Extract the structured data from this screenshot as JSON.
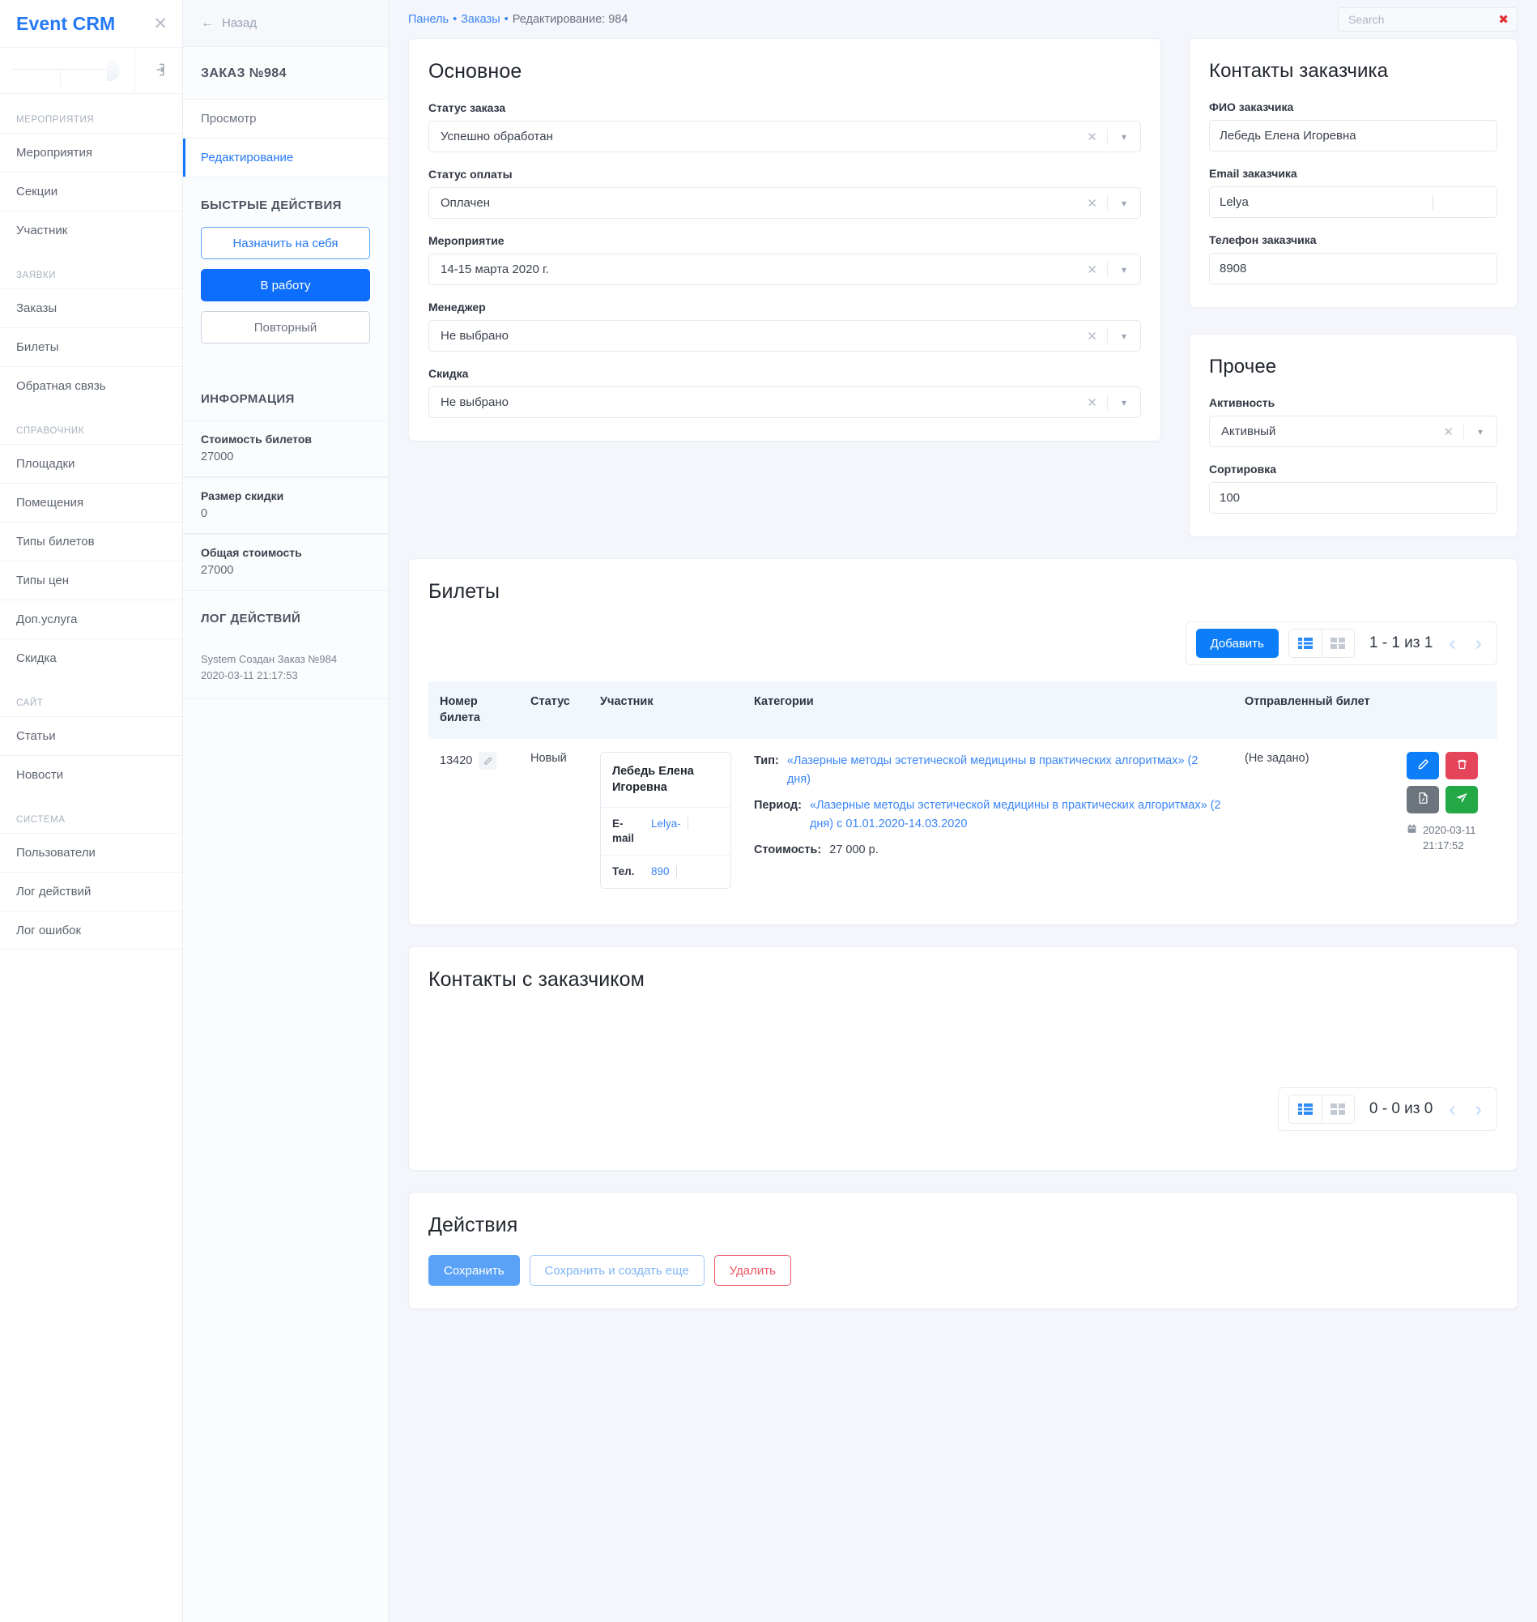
{
  "sidebar": {
    "brand": "Event CRM",
    "close_icon": "close-icon",
    "logout_icon": "logout-icon",
    "groups": [
      {
        "title": "МЕРОПРИЯТИЯ",
        "items": [
          "Мероприятия",
          "Секции",
          "Участник"
        ]
      },
      {
        "title": "ЗАЯВКИ",
        "items": [
          "Заказы",
          "Билеты",
          "Обратная связь"
        ]
      },
      {
        "title": "СПРАВОЧНИК",
        "items": [
          "Площадки",
          "Помещения",
          "Типы билетов",
          "Типы цен",
          "Доп.услуга",
          "Скидка"
        ]
      },
      {
        "title": "САЙТ",
        "items": [
          "Статьи",
          "Новости"
        ]
      },
      {
        "title": "СИСТЕМА",
        "items": [
          "Пользователи",
          "Лог действий",
          "Лог ошибок"
        ]
      }
    ]
  },
  "subsidebar": {
    "back_label": "Назад",
    "back_icon": "arrow-left-icon",
    "order_title": "ЗАКАЗ №984",
    "links": [
      {
        "label": "Просмотр",
        "active": false
      },
      {
        "label": "Редактирование",
        "active": true
      }
    ],
    "quick_actions_title": "БЫСТРЫЕ ДЕЙСТВИЯ",
    "quick_actions": [
      {
        "label": "Назначить на себя",
        "style": "outline-blue"
      },
      {
        "label": "В работу",
        "style": "solid-blue"
      },
      {
        "label": "Повторный",
        "style": "outline-grey"
      }
    ],
    "info_title": "ИНФОРМАЦИЯ",
    "info": [
      {
        "label": "Стоимость билетов",
        "value": "27000"
      },
      {
        "label": "Размер скидки",
        "value": "0"
      },
      {
        "label": "Общая стоимость",
        "value": "27000"
      }
    ],
    "log_title": "ЛОГ ДЕЙСТВИЙ",
    "log_entries": [
      {
        "text": "System Создан Заказ №984",
        "time": "2020-03-11 21:17:53"
      }
    ]
  },
  "topbar": {
    "crumb1": "Панель",
    "crumb2": "Заказы",
    "crumb3": "Редактирование: 984",
    "sep": "•",
    "search_placeholder": "Search",
    "search_value": "",
    "search_clear_icon": "close-icon"
  },
  "main_card": {
    "title": "Основное",
    "fields": [
      {
        "label": "Статус заказа",
        "value": "Успешно обработан"
      },
      {
        "label": "Статус оплаты",
        "value": "Оплачен"
      },
      {
        "label": "Мероприятие",
        "value": "14-15 марта 2020 г."
      },
      {
        "label": "Менеджер",
        "value": "Не выбрано"
      },
      {
        "label": "Скидка",
        "value": "Не выбрано"
      }
    ],
    "clear_icon": "×",
    "caret_icon": "chevron-down-icon"
  },
  "contacts_card": {
    "title": "Контакты заказчика",
    "fields": [
      {
        "label": "ФИО заказчика",
        "value": "Лебедь Елена Игоревна",
        "redacted": false
      },
      {
        "label": "Email заказчика",
        "value": "Lelya",
        "redacted": true
      },
      {
        "label": "Телефон заказчика",
        "value": "8908",
        "redacted": true
      }
    ]
  },
  "other_card": {
    "title": "Прочее",
    "activity_label": "Активность",
    "activity_value": "Активный",
    "sort_label": "Сортировка",
    "sort_value": "100"
  },
  "tickets": {
    "title": "Билеты",
    "toolbar": {
      "add_label": "Добавить",
      "view_list_icon": "list-view-icon",
      "view_grid_icon": "grid-view-icon",
      "pager_count": "1 - 1 из 1",
      "prev_icon": "chevron-left-icon",
      "next_icon": "chevron-right-icon"
    },
    "columns": [
      "Номер билета",
      "Статус",
      "Участник",
      "Категории",
      "Отправленный билет",
      ""
    ],
    "row": {
      "number": "13420",
      "edit_icon": "pencil-icon",
      "status": "Новый",
      "participant": {
        "name": "Лебедь Елена Игоревна",
        "email_key": "E-mail",
        "email_value": "Lelya-",
        "phone_key": "Тел.",
        "phone_value": "890"
      },
      "categories": [
        {
          "key": "Тип:",
          "value": "«Лазерные методы эстетической медицины в практических алгоритмах» (2 дня)",
          "link": true
        },
        {
          "key": "Период:",
          "value": "«Лазерные методы эстетической медицины в практических алгоритмах» (2 дня) с 01.01.2020-14.03.2020",
          "link": true
        },
        {
          "key": "Стоимость:",
          "value": "27 000 р.",
          "link": false
        }
      ],
      "sent_ticket": "(Не задано)",
      "actions": [
        {
          "name": "edit",
          "icon": "pencil-icon",
          "color": "#0d7ef7"
        },
        {
          "name": "delete",
          "icon": "trash-icon",
          "color": "#e4455a"
        },
        {
          "name": "pdf",
          "icon": "pdf-file-icon",
          "color": "#6c757d"
        },
        {
          "name": "send",
          "icon": "send-icon",
          "color": "#22a845"
        }
      ],
      "date_icon": "calendar-icon",
      "date": "2020-03-11 21:17:52"
    }
  },
  "client_contacts": {
    "title": "Контакты с заказчиком",
    "toolbar": {
      "view_list_icon": "list-view-icon",
      "view_grid_icon": "grid-view-icon",
      "pager_count": "0 - 0 из 0",
      "prev_icon": "chevron-left-icon",
      "next_icon": "chevron-right-icon"
    }
  },
  "actions_card": {
    "title": "Действия",
    "save": "Сохранить",
    "save_create": "Сохранить и создать еще",
    "delete": "Удалить"
  },
  "colors": {
    "brand": "#2579f5",
    "accent_blue": "#0d6efd",
    "danger": "#e4455a",
    "success": "#22a845",
    "page_bg": "#f4f6fb"
  }
}
